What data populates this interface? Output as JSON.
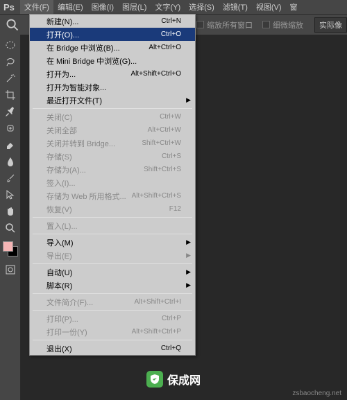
{
  "logo": "Ps",
  "menubar": {
    "items": [
      "文件(F)",
      "编辑(E)",
      "图像(I)",
      "图层(L)",
      "文字(Y)",
      "选择(S)",
      "滤镜(T)",
      "视图(V)",
      "窗"
    ]
  },
  "toolbar": {
    "fit_all": "缩放所有窗口",
    "fine_zoom": "细微缩放",
    "actual": "实际像"
  },
  "dropdown": {
    "items": [
      {
        "label": "新建(N)...",
        "shortcut": "Ctrl+N",
        "type": "item"
      },
      {
        "label": "打开(O)...",
        "shortcut": "Ctrl+O",
        "type": "item",
        "highlighted": true
      },
      {
        "label": "在 Bridge 中浏览(B)...",
        "shortcut": "Alt+Ctrl+O",
        "type": "item"
      },
      {
        "label": "在 Mini Bridge 中浏览(G)...",
        "shortcut": "",
        "type": "item"
      },
      {
        "label": "打开为...",
        "shortcut": "Alt+Shift+Ctrl+O",
        "type": "item"
      },
      {
        "label": "打开为智能对象...",
        "shortcut": "",
        "type": "item"
      },
      {
        "label": "最近打开文件(T)",
        "shortcut": "",
        "type": "submenu"
      },
      {
        "type": "sep"
      },
      {
        "label": "关闭(C)",
        "shortcut": "Ctrl+W",
        "type": "item",
        "disabled": true
      },
      {
        "label": "关闭全部",
        "shortcut": "Alt+Ctrl+W",
        "type": "item",
        "disabled": true
      },
      {
        "label": "关闭并转到 Bridge...",
        "shortcut": "Shift+Ctrl+W",
        "type": "item",
        "disabled": true
      },
      {
        "label": "存储(S)",
        "shortcut": "Ctrl+S",
        "type": "item",
        "disabled": true
      },
      {
        "label": "存储为(A)...",
        "shortcut": "Shift+Ctrl+S",
        "type": "item",
        "disabled": true
      },
      {
        "label": "签入(I)...",
        "shortcut": "",
        "type": "item",
        "disabled": true
      },
      {
        "label": "存储为 Web 所用格式...",
        "shortcut": "Alt+Shift+Ctrl+S",
        "type": "item",
        "disabled": true
      },
      {
        "label": "恢复(V)",
        "shortcut": "F12",
        "type": "item",
        "disabled": true
      },
      {
        "type": "sep"
      },
      {
        "label": "置入(L)...",
        "shortcut": "",
        "type": "item",
        "disabled": true
      },
      {
        "type": "sep"
      },
      {
        "label": "导入(M)",
        "shortcut": "",
        "type": "submenu"
      },
      {
        "label": "导出(E)",
        "shortcut": "",
        "type": "submenu",
        "disabled": true
      },
      {
        "type": "sep"
      },
      {
        "label": "自动(U)",
        "shortcut": "",
        "type": "submenu"
      },
      {
        "label": "脚本(R)",
        "shortcut": "",
        "type": "submenu"
      },
      {
        "type": "sep"
      },
      {
        "label": "文件简介(F)...",
        "shortcut": "Alt+Shift+Ctrl+I",
        "type": "item",
        "disabled": true
      },
      {
        "type": "sep"
      },
      {
        "label": "打印(P)...",
        "shortcut": "Ctrl+P",
        "type": "item",
        "disabled": true
      },
      {
        "label": "打印一份(Y)",
        "shortcut": "Alt+Shift+Ctrl+P",
        "type": "item",
        "disabled": true
      },
      {
        "type": "sep"
      },
      {
        "label": "退出(X)",
        "shortcut": "Ctrl+Q",
        "type": "item"
      }
    ]
  },
  "watermark": {
    "brand": "保成网",
    "url": "zsbaocheng.net"
  }
}
